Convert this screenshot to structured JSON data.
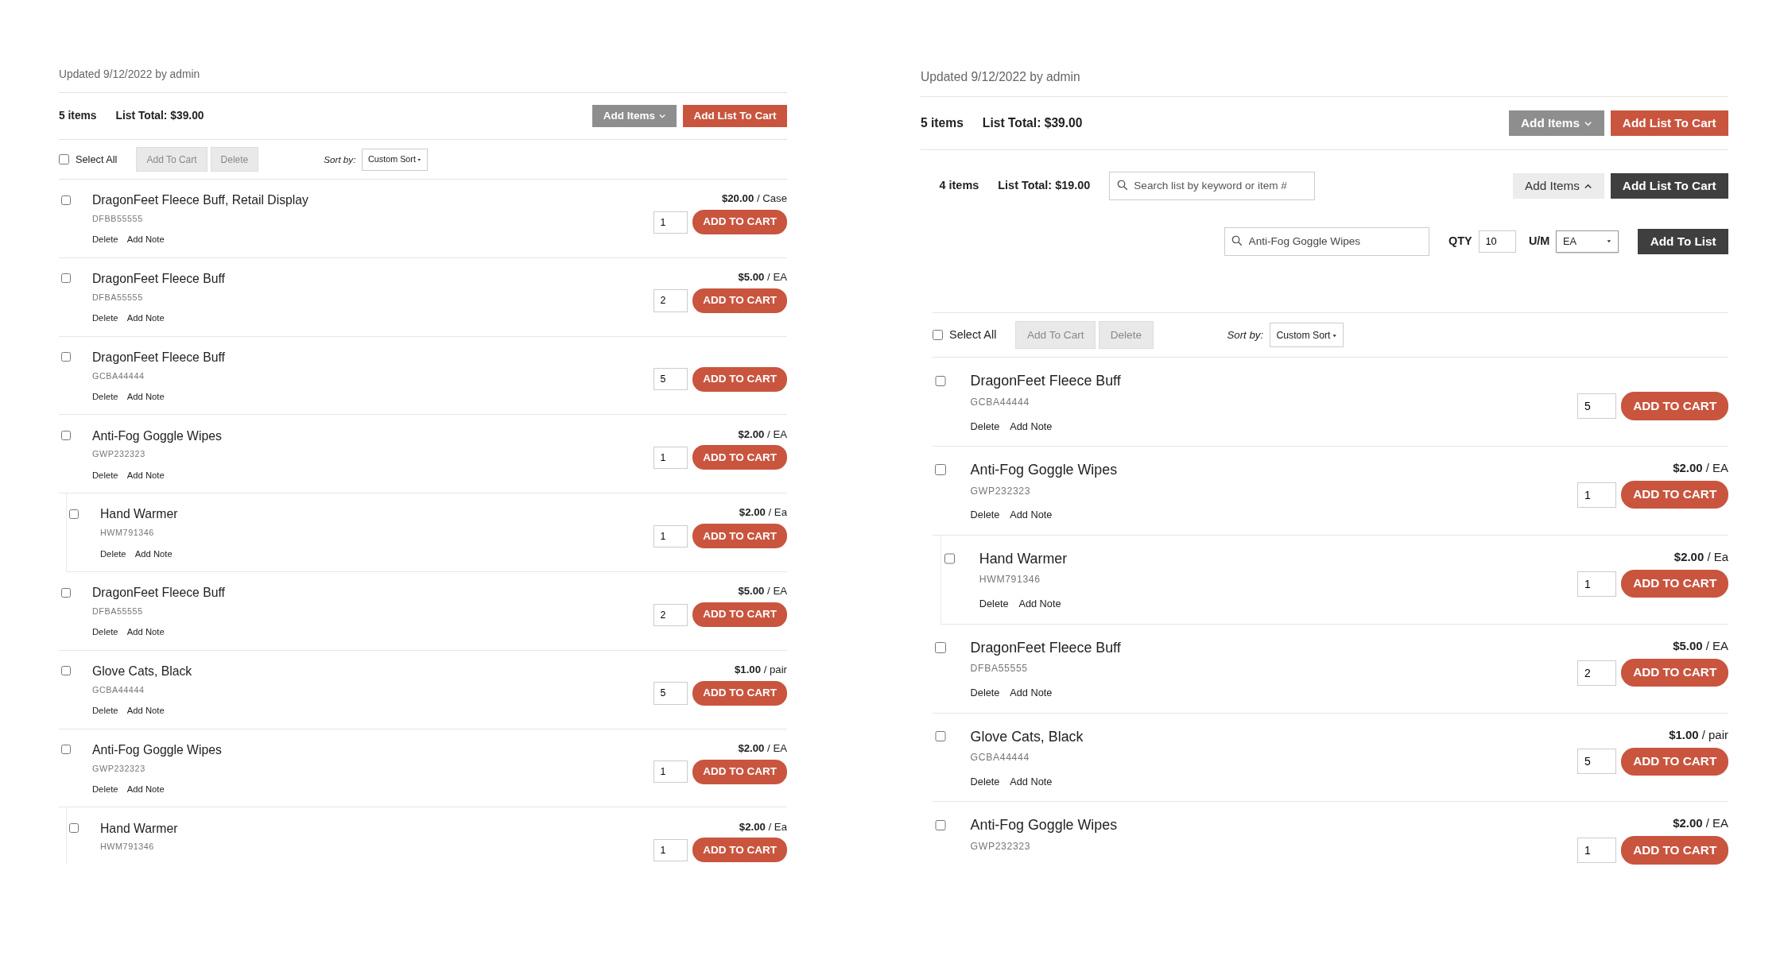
{
  "panels": [
    {
      "updated": "Updated 9/12/2022 by admin",
      "header": {
        "count": "5 items",
        "total": "List Total: $39.00",
        "add_items": {
          "label": "Add Items",
          "expanded": false
        },
        "add_list": {
          "label": "Add List To Cart"
        }
      },
      "toolbar": {
        "select_all": "Select All",
        "checked": false,
        "buttons": [
          {
            "label": "Add To Cart",
            "disabled": true
          },
          {
            "label": "Delete",
            "disabled": true
          }
        ],
        "sort_label": "Sort by:",
        "sort_value": "Custom Sort"
      },
      "items": [
        {
          "name": "DragonFeet Fleece Buff, Retail Display",
          "code": "DFBB55555",
          "price": "$20.00",
          "unit": "/ Case",
          "qty": "1",
          "cart": "ADD TO CART",
          "actions": [
            "Delete",
            "Add Note"
          ],
          "checked": false
        },
        {
          "name": "DragonFeet Fleece Buff",
          "code": "DFBA55555",
          "price": "$5.00",
          "unit": "/ EA",
          "qty": "2",
          "cart": "ADD TO CART",
          "actions": [
            "Delete",
            "Add Note"
          ],
          "checked": false
        },
        {
          "name": "DragonFeet Fleece Buff",
          "code": "GCBA44444",
          "qty": "5",
          "cart": "ADD TO CART",
          "actions": [
            "Delete",
            "Add Note"
          ],
          "checked": false
        },
        {
          "name": "Anti-Fog Goggle Wipes",
          "code": "GWP232323",
          "price": "$2.00",
          "unit": "/ EA",
          "qty": "1",
          "cart": "ADD TO CART",
          "actions": [
            "Delete",
            "Add Note"
          ],
          "checked": false,
          "children": [
            {
              "name": "Hand Warmer",
              "code": "HWM791346",
              "price": "$2.00",
              "unit": "/ Ea",
              "qty": "1",
              "cart": "ADD TO CART",
              "actions": [
                "Delete",
                "Add Note"
              ],
              "checked": false
            }
          ]
        },
        {
          "name": "DragonFeet Fleece Buff",
          "code": "DFBA55555",
          "price": "$5.00",
          "unit": "/ EA",
          "qty": "2",
          "cart": "ADD TO CART",
          "actions": [
            "Delete",
            "Add Note"
          ],
          "checked": false
        },
        {
          "name": "Glove Cats, Black",
          "code": "GCBA44444",
          "price": "$1.00",
          "unit": "/ pair",
          "qty": "5",
          "cart": "ADD TO CART",
          "actions": [
            "Delete",
            "Add Note"
          ],
          "checked": false
        },
        {
          "name": "Anti-Fog Goggle Wipes",
          "code": "GWP232323",
          "price": "$2.00",
          "unit": "/ EA",
          "qty": "1",
          "cart": "ADD TO CART",
          "actions": [
            "Delete",
            "Add Note"
          ],
          "checked": false,
          "children": [
            {
              "name": "Hand Warmer",
              "code": "HWM791346",
              "price": "$2.00",
              "unit": "/ Ea",
              "qty": "1",
              "cart": "ADD TO CART",
              "checked": false
            }
          ]
        }
      ]
    },
    {
      "updated": "Updated 9/12/2022 by admin",
      "header": {
        "count": "5 items",
        "total": "List Total: $39.00",
        "add_items": {
          "label": "Add Items",
          "expanded": false
        },
        "add_list": {
          "label": "Add List To Cart"
        }
      },
      "sublist": {
        "count": "4 items",
        "total": "List Total: $19.00",
        "search": {
          "placeholder": "Search list by keyword or item #"
        },
        "add_items": {
          "label": "Add Items",
          "expanded": true
        },
        "add_list": {
          "label": "Add List To Cart"
        },
        "quick_add": {
          "item": "Anti-Fog Goggle Wipes",
          "qty_label": "QTY",
          "qty": "10",
          "um_label": "U/M",
          "um": "EA",
          "button": "Add To List"
        }
      },
      "toolbar": {
        "select_all": "Select All",
        "checked": false,
        "buttons": [
          {
            "label": "Add To Cart",
            "disabled": true
          },
          {
            "label": "Delete",
            "disabled": true
          }
        ],
        "sort_label": "Sort by:",
        "sort_value": "Custom Sort"
      },
      "items": [
        {
          "name": "DragonFeet Fleece Buff",
          "code": "GCBA44444",
          "qty": "5",
          "cart": "ADD TO CART",
          "actions": [
            "Delete",
            "Add Note"
          ],
          "checked": false
        },
        {
          "name": "Anti-Fog Goggle Wipes",
          "code": "GWP232323",
          "price": "$2.00",
          "unit": "/ EA",
          "qty": "1",
          "cart": "ADD TO CART",
          "actions": [
            "Delete",
            "Add Note"
          ],
          "checked": false,
          "children": [
            {
              "name": "Hand Warmer",
              "code": "HWM791346",
              "price": "$2.00",
              "unit": "/ Ea",
              "qty": "1",
              "cart": "ADD TO CART",
              "actions": [
                "Delete",
                "Add Note"
              ],
              "checked": false
            }
          ]
        },
        {
          "name": "DragonFeet Fleece Buff",
          "code": "DFBA55555",
          "price": "$5.00",
          "unit": "/ EA",
          "qty": "2",
          "cart": "ADD TO CART",
          "actions": [
            "Delete",
            "Add Note"
          ],
          "checked": false
        },
        {
          "name": "Glove Cats, Black",
          "code": "GCBA44444",
          "price": "$1.00",
          "unit": "/ pair",
          "qty": "5",
          "cart": "ADD TO CART",
          "actions": [
            "Delete",
            "Add Note"
          ],
          "checked": false
        },
        {
          "name": "Anti-Fog Goggle Wipes",
          "code": "GWP232323",
          "price": "$2.00",
          "unit": "/ EA",
          "qty": "1",
          "cart": "ADD TO CART",
          "checked": false
        }
      ]
    }
  ]
}
